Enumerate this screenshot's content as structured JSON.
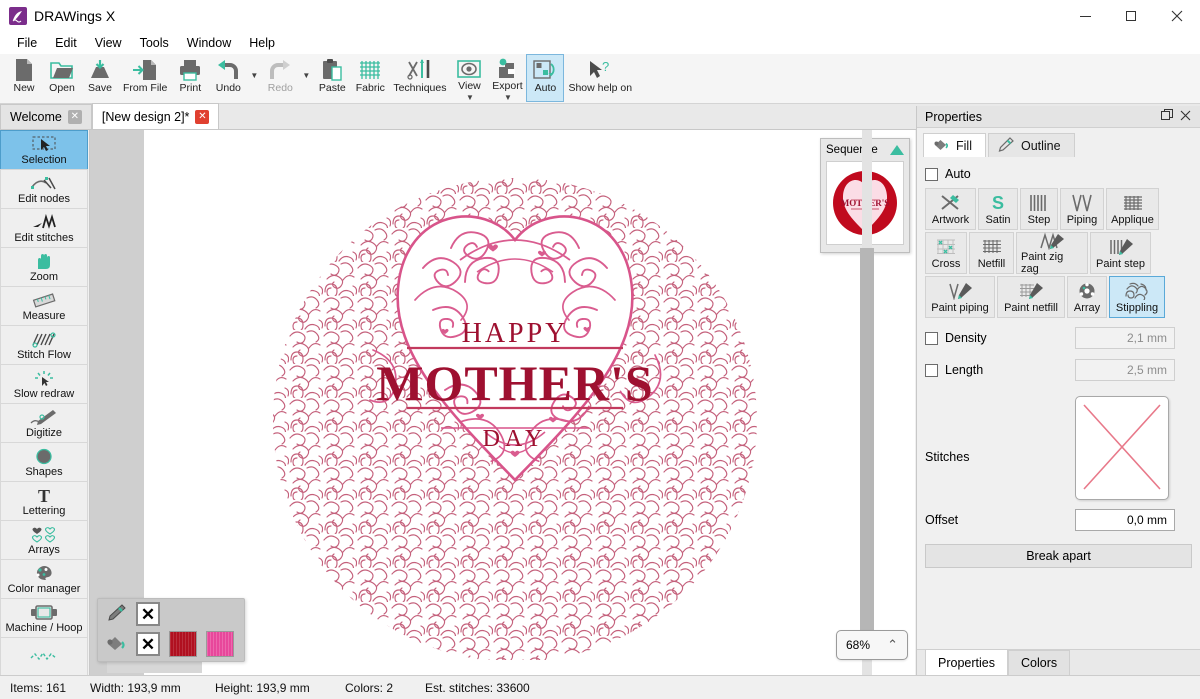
{
  "window": {
    "title": "DRAWings X",
    "logo_icon": "drawings-logo-icon",
    "minimize_icon": "minimize-icon",
    "maximize_icon": "maximize-icon",
    "close_icon": "close-icon"
  },
  "menubar": {
    "items": [
      "File",
      "Edit",
      "View",
      "Tools",
      "Window",
      "Help"
    ]
  },
  "toolbar": {
    "items": [
      {
        "label": "New",
        "icon": "new-document-icon",
        "state": "normal"
      },
      {
        "label": "Open",
        "icon": "open-folder-icon",
        "state": "normal"
      },
      {
        "label": "Save",
        "icon": "save-icon",
        "state": "normal"
      },
      {
        "label": "From File",
        "icon": "import-from-file-icon",
        "state": "normal"
      },
      {
        "label": "Print",
        "icon": "printer-icon",
        "state": "normal"
      },
      {
        "label": "Undo",
        "icon": "undo-arrow-icon",
        "state": "normal",
        "dropdown": true
      },
      {
        "label": "Redo",
        "icon": "redo-arrow-icon",
        "state": "disabled",
        "dropdown": true
      },
      {
        "label": "Paste",
        "icon": "clipboard-paste-icon",
        "state": "normal"
      },
      {
        "label": "Fabric",
        "icon": "fabric-grid-icon",
        "state": "normal"
      },
      {
        "label": "Techniques",
        "icon": "techniques-needle-icon",
        "state": "normal"
      },
      {
        "label": "View",
        "icon": "view-eye-icon",
        "state": "normal",
        "dropdown": true
      },
      {
        "label": "Export",
        "icon": "export-machine-icon",
        "state": "normal",
        "dropdown": true
      },
      {
        "label": "Auto",
        "icon": "auto-sequence-icon",
        "state": "active"
      },
      {
        "label": "Show help on",
        "icon": "help-cursor-icon",
        "state": "normal"
      }
    ]
  },
  "doctabs": {
    "tabs": [
      {
        "label": "Welcome",
        "active": false,
        "close_icon": "close-tab-icon"
      },
      {
        "label": "[New design 2]*",
        "active": true,
        "close_icon": "close-tab-icon"
      }
    ]
  },
  "sidebar": {
    "items": [
      {
        "label": "Selection",
        "icon": "selection-arrow-icon",
        "active": true
      },
      {
        "label": "Edit nodes",
        "icon": "edit-nodes-icon",
        "active": false
      },
      {
        "label": "Edit stitches",
        "icon": "edit-stitches-icon",
        "active": false
      },
      {
        "label": "Zoom",
        "icon": "zoom-hand-icon",
        "active": false
      },
      {
        "label": "Measure",
        "icon": "measure-ruler-icon",
        "active": false
      },
      {
        "label": "Stitch Flow",
        "icon": "stitch-flow-icon",
        "active": false
      },
      {
        "label": "Slow redraw",
        "icon": "slow-redraw-icon",
        "active": false
      },
      {
        "label": "Digitize",
        "icon": "digitize-pen-icon",
        "active": false
      },
      {
        "label": "Shapes",
        "icon": "shapes-circle-icon",
        "active": false
      },
      {
        "label": "Lettering",
        "icon": "lettering-text-icon",
        "active": false
      },
      {
        "label": "Arrays",
        "icon": "arrays-hearts-icon",
        "active": false
      },
      {
        "label": "Color manager",
        "icon": "color-palette-icon",
        "active": false
      },
      {
        "label": "Machine / Hoop",
        "icon": "machine-hoop-icon",
        "active": false
      },
      {
        "label": "",
        "icon": "stitch-path-icon",
        "active": false
      }
    ]
  },
  "canvas": {
    "design": {
      "title_line1": "HAPPY",
      "title_line2": "MOTHER'S",
      "title_line3": "DAY",
      "stipple_color": "#c4607b",
      "filigree_color": "#d8548a",
      "text_color": "#9e1030"
    },
    "sequence": {
      "title": "Sequence",
      "collapse_icon": "collapse-triangle-icon",
      "thumbnail_icon": "design-thumbnail",
      "thumb_bg_color": "#c00a1e",
      "thumb_heart_color": "#fbdde6"
    },
    "zoom": {
      "level": "68%",
      "chevron_icon": "chevron-up-icon"
    },
    "slider": {
      "icon": "vertical-slider"
    }
  },
  "palette": {
    "pen_icon": "pen-outline-icon",
    "bucket_icon": "fill-bucket-icon",
    "none_icon": "no-color-icon",
    "none_glyph": "✕",
    "swatches": [
      {
        "name": "dark-red-thread",
        "color": "#b01020"
      },
      {
        "name": "pink-thread",
        "color": "#e8479b"
      }
    ]
  },
  "properties": {
    "header": {
      "title": "Properties",
      "float_icon": "undock-icon",
      "close_icon": "close-panel-icon"
    },
    "tabs": [
      {
        "label": "Fill",
        "icon": "fill-bucket-icon",
        "active": true
      },
      {
        "label": "Outline",
        "icon": "outline-pen-icon",
        "active": false
      }
    ],
    "auto": {
      "label": "Auto",
      "checked": false
    },
    "fill_types": [
      {
        "label": "Artwork",
        "icon": "artwork-icon",
        "active": false
      },
      {
        "label": "Satin",
        "icon": "satin-icon",
        "active": false
      },
      {
        "label": "Step",
        "icon": "step-icon",
        "active": false
      },
      {
        "label": "Piping",
        "icon": "piping-icon",
        "active": false
      },
      {
        "label": "Applique",
        "icon": "applique-icon",
        "active": false
      },
      {
        "label": "Cross",
        "icon": "cross-stitch-icon",
        "active": false
      },
      {
        "label": "Netfill",
        "icon": "netfill-icon",
        "active": false
      },
      {
        "label": "Paint zig zag",
        "icon": "paint-zigzag-icon",
        "active": false
      },
      {
        "label": "Paint step",
        "icon": "paint-step-icon",
        "active": false
      },
      {
        "label": "Paint piping",
        "icon": "paint-piping-icon",
        "active": false
      },
      {
        "label": "Paint netfill",
        "icon": "paint-netfill-icon",
        "active": false
      },
      {
        "label": "Array",
        "icon": "array-icon",
        "active": false
      },
      {
        "label": "Stippling",
        "icon": "stippling-icon",
        "active": true
      }
    ],
    "density": {
      "label": "Density",
      "checked": false,
      "value": "2,1 mm",
      "enabled": false
    },
    "length": {
      "label": "Length",
      "checked": false,
      "value": "2,5 mm",
      "enabled": false
    },
    "stitches": {
      "label": "Stitches",
      "value": "None",
      "preview_icon": "none-cross-icon"
    },
    "offset": {
      "label": "Offset",
      "value": "0,0 mm",
      "enabled": true
    },
    "break_apart": {
      "label": "Break apart"
    },
    "bottom_tabs": [
      {
        "label": "Properties",
        "active": true
      },
      {
        "label": "Colors",
        "active": false
      }
    ]
  },
  "statusbar": {
    "items": [
      "Items: 161",
      "Width: 193,9 mm",
      "Height: 193,9 mm",
      "Colors: 2",
      "Est. stitches: 33600"
    ]
  },
  "colors": {
    "accent_teal": "#3bbda0",
    "icon_gray": "#6b6b6b",
    "select_blue": "#7dc2ea",
    "highlight_blue": "#cce8f7"
  }
}
